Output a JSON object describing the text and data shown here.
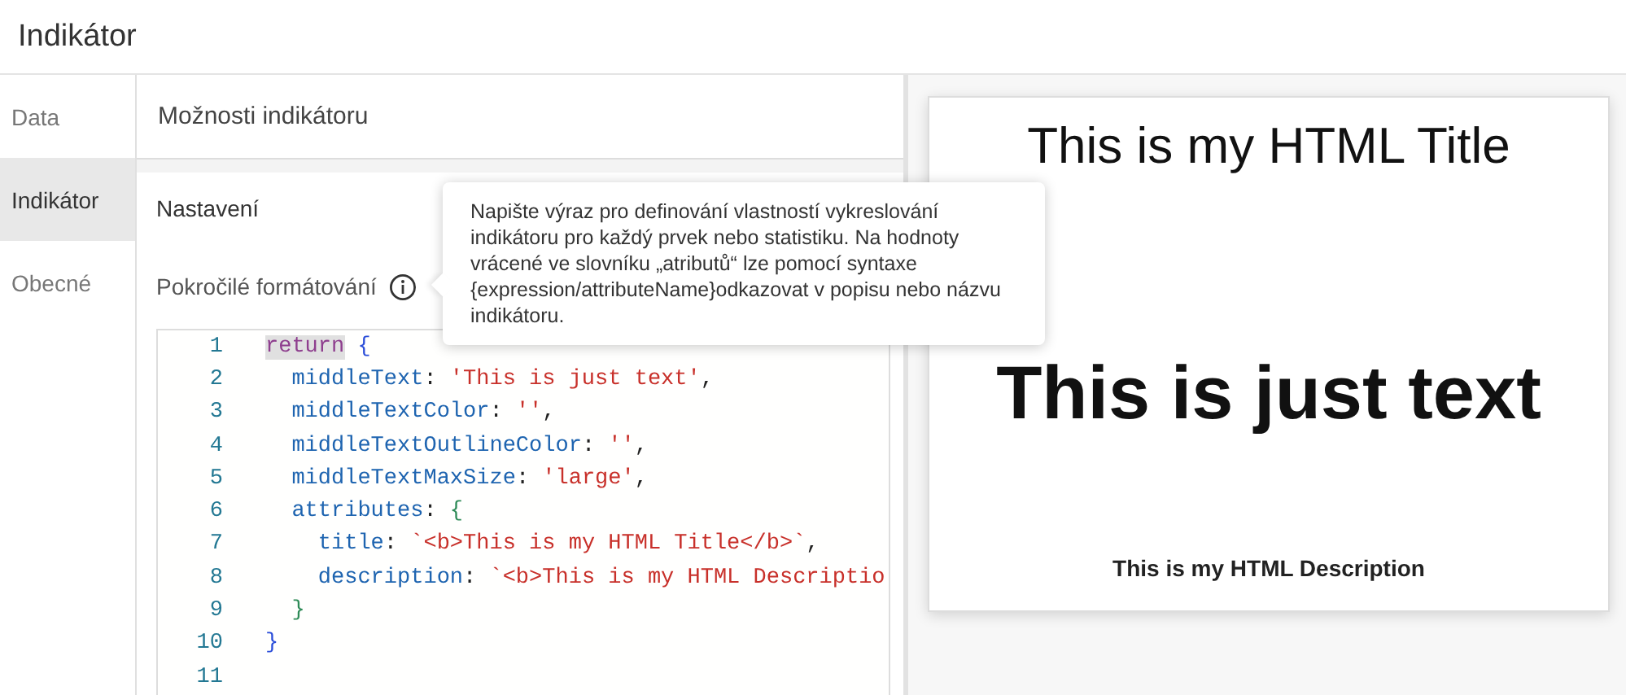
{
  "window": {
    "title": "Indikátor"
  },
  "nav": [
    {
      "label": "Data",
      "selected": false
    },
    {
      "label": "Indikátor",
      "selected": true
    },
    {
      "label": "Obecné",
      "selected": false
    }
  ],
  "panel": {
    "title": "Možnosti indikátoru",
    "section": "Nastavení",
    "field_label": "Pokročilé formátování"
  },
  "tooltip": "Napište výraz pro definování vlastností vykreslování indikátoru pro každý prvek nebo statistiku. Na hodnoty vrácené ve slovníku „atributů“ lze pomocí syntaxe {expression/attributeName}odkazovat v popisu nebo názvu indikátoru.",
  "code": [
    {
      "number": "1",
      "tokens": [
        {
          "kind": "keyword",
          "text": "return"
        },
        {
          "kind": "brace",
          "text": " {"
        }
      ]
    },
    {
      "number": "2",
      "tokens": [
        {
          "kind": "prop",
          "text": "  middleText"
        },
        {
          "kind": "plain",
          "text": ": "
        },
        {
          "kind": "string",
          "text": "'This is just text'"
        },
        {
          "kind": "plain",
          "text": ","
        }
      ]
    },
    {
      "number": "3",
      "tokens": [
        {
          "kind": "prop",
          "text": "  middleTextColor"
        },
        {
          "kind": "plain",
          "text": ": "
        },
        {
          "kind": "string",
          "text": "''"
        },
        {
          "kind": "plain",
          "text": ","
        }
      ]
    },
    {
      "number": "4",
      "tokens": [
        {
          "kind": "prop",
          "text": "  middleTextOutlineColor"
        },
        {
          "kind": "plain",
          "text": ": "
        },
        {
          "kind": "string",
          "text": "''"
        },
        {
          "kind": "plain",
          "text": ","
        }
      ]
    },
    {
      "number": "5",
      "tokens": [
        {
          "kind": "prop",
          "text": "  middleTextMaxSize"
        },
        {
          "kind": "plain",
          "text": ": "
        },
        {
          "kind": "string",
          "text": "'large'"
        },
        {
          "kind": "plain",
          "text": ","
        }
      ]
    },
    {
      "number": "6",
      "tokens": [
        {
          "kind": "prop",
          "text": "  attributes"
        },
        {
          "kind": "plain",
          "text": ": "
        },
        {
          "kind": "brace2",
          "text": "{"
        }
      ]
    },
    {
      "number": "7",
      "tokens": [
        {
          "kind": "prop",
          "text": "    title"
        },
        {
          "kind": "plain",
          "text": ": "
        },
        {
          "kind": "string",
          "text": "`<b>This is my HTML Title</b>`"
        },
        {
          "kind": "plain",
          "text": ","
        }
      ]
    },
    {
      "number": "8",
      "tokens": [
        {
          "kind": "prop",
          "text": "    description"
        },
        {
          "kind": "plain",
          "text": ": "
        },
        {
          "kind": "string",
          "text": "`<b>This is my HTML Descriptio"
        }
      ]
    },
    {
      "number": "9",
      "tokens": [
        {
          "kind": "brace2",
          "text": "  }"
        }
      ]
    },
    {
      "number": "10",
      "tokens": [
        {
          "kind": "brace",
          "text": "}"
        }
      ]
    },
    {
      "number": "11"
    }
  ],
  "preview": {
    "title": "This is my HTML Title",
    "middle_text": "This is just text",
    "description": "This is my HTML Description"
  }
}
